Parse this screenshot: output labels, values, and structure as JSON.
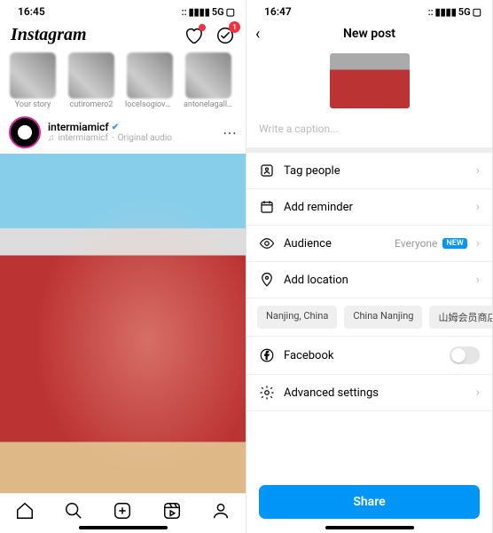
{
  "left": {
    "status": {
      "time": "16:45",
      "net": "5G",
      "signal": "••••"
    },
    "logo": "Instagram",
    "messages_badge": "1",
    "stories": [
      {
        "label": "Your story"
      },
      {
        "label": "cutiromero2"
      },
      {
        "label": "locelsogiovani"
      },
      {
        "label": "antonelagaller"
      }
    ],
    "post": {
      "username": "intermiamicf",
      "sub1": "intermiamicf",
      "sub2": "Original audio"
    }
  },
  "right": {
    "status": {
      "time": "16:47",
      "net": "5G"
    },
    "title": "New post",
    "caption_placeholder": "Write a caption...",
    "rows": {
      "tag": "Tag people",
      "reminder": "Add reminder",
      "audience": "Audience",
      "audience_value": "Everyone",
      "audience_badge": "NEW",
      "location": "Add location",
      "facebook": "Facebook",
      "advanced": "Advanced settings"
    },
    "chips": [
      "Nanjing, China",
      "China Nanjing",
      "山姆会员商店 Sam"
    ],
    "share": "Share"
  }
}
